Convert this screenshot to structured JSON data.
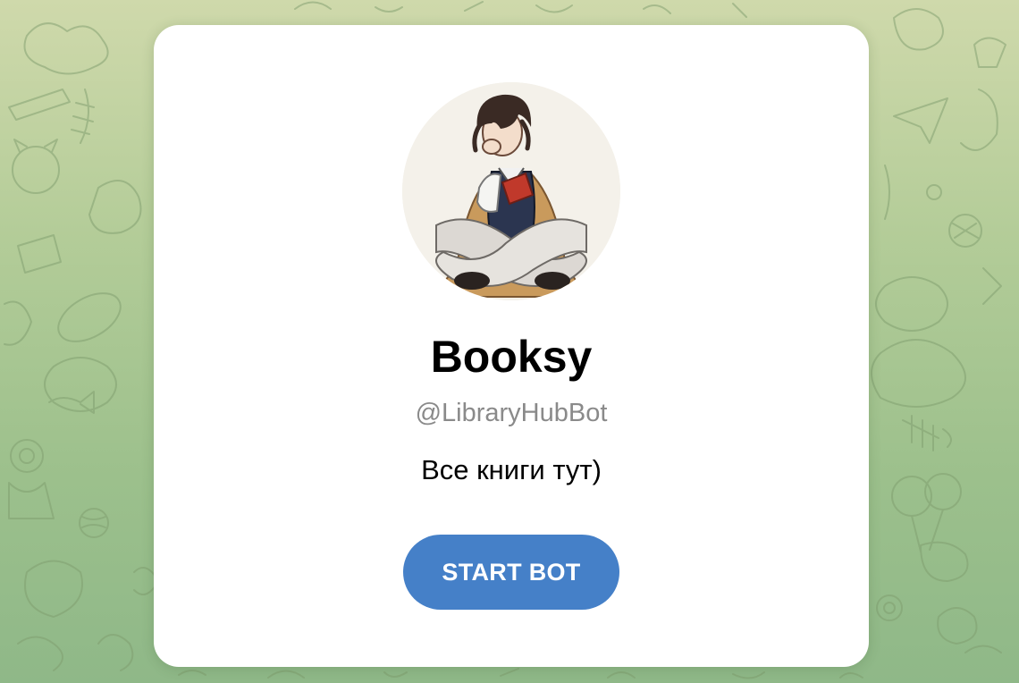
{
  "background": {
    "pattern_icon": "doodle-pattern-icon",
    "colors": {
      "top": "#cfd9ab",
      "bottom": "#8fb888"
    }
  },
  "profile": {
    "avatar_icon": "bot-avatar-image",
    "name": "Booksy",
    "username": "@LibraryHubBot",
    "description": "Все книги тут)"
  },
  "actions": {
    "start_label": "START BOT"
  },
  "colors": {
    "accent": "#4580c8",
    "card": "#ffffff",
    "muted_text": "#8a8a8a"
  }
}
